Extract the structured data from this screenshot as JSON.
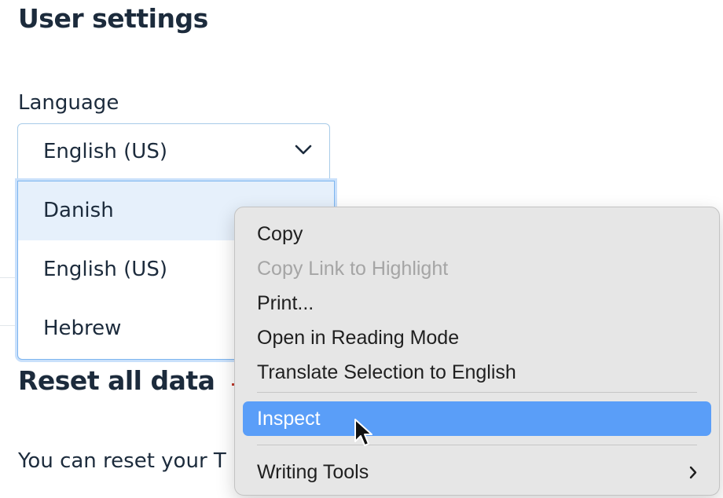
{
  "page": {
    "title": "User settings",
    "language_label": "Language",
    "language_select": {
      "value": "English (US)",
      "options": [
        "Danish",
        "English (US)",
        "Hebrew"
      ],
      "highlighted_option": "Danish"
    },
    "reset_section_title": "Reset all data",
    "reset_text": "You can reset your T"
  },
  "context_menu": {
    "items": [
      {
        "label": "Copy",
        "state": "enabled"
      },
      {
        "label": "Copy Link to Highlight",
        "state": "disabled"
      },
      {
        "label": "Print...",
        "state": "enabled"
      },
      {
        "label": "Open in Reading Mode",
        "state": "enabled"
      },
      {
        "label": "Translate Selection to English",
        "state": "enabled"
      },
      {
        "label": "Inspect",
        "state": "selected"
      },
      {
        "label": "Writing Tools",
        "state": "enabled",
        "submenu": true
      }
    ]
  },
  "icons": {
    "select_chevron": "chevron-down-icon",
    "submenu_arrow": "chevron-right-icon",
    "pointer": "mouse-cursor-icon"
  },
  "colors": {
    "text": "#1c2b3c",
    "dropdown_focus": "#7db5ef",
    "highlighted_option_bg": "#e6f0fb",
    "menu_bg": "#e6e6e6",
    "menu_selected": "#5a9ef8",
    "menu_disabled_text": "#a5a5a5"
  }
}
